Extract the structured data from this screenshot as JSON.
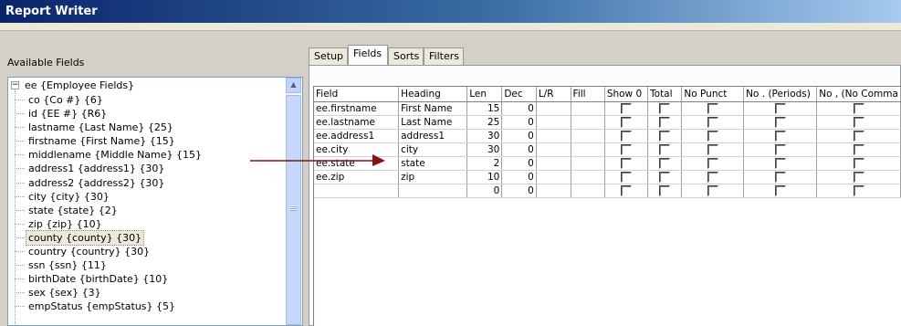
{
  "window": {
    "title": "Report Writer"
  },
  "available_fields": {
    "label": "Available Fields",
    "root": {
      "label": "ee {Employee Fields}",
      "expander": "−"
    },
    "items": [
      "co {Co #} {6}",
      "id {EE #} {R6}",
      "lastname {Last Name} {25}",
      "firstname {First Name} {15}",
      "middlename {Middle Name} {15}",
      "address1 {address1} {30}",
      "address2 {address2} {30}",
      "city {city} {30}",
      "state {state} {2}",
      "zip {zip} {10}",
      "county {county} {30}",
      "country {country} {30}",
      "ssn {ssn} {11}",
      "birthDate {birthDate} {10}",
      "sex {sex} {3}",
      "empStatus {empStatus} {5}"
    ],
    "selected_index": 10
  },
  "tabs": [
    {
      "label": "Setup"
    },
    {
      "label": "Fields"
    },
    {
      "label": "Sorts"
    },
    {
      "label": "Filters"
    }
  ],
  "active_tab": "Fields",
  "grid": {
    "columns": [
      "Field",
      "Heading",
      "Len",
      "Dec",
      "L/R",
      "Fill",
      "Show 0",
      "Total",
      "No Punct",
      "No . (Periods)",
      "No , (No Comma"
    ],
    "rows": [
      {
        "field": "ee.firstname",
        "heading": "First Name",
        "len": "15",
        "dec": "0"
      },
      {
        "field": "ee.lastname",
        "heading": "Last Name",
        "len": "25",
        "dec": "0"
      },
      {
        "field": "ee.address1",
        "heading": "address1",
        "len": "30",
        "dec": "0"
      },
      {
        "field": "ee.city",
        "heading": "city",
        "len": "30",
        "dec": "0"
      },
      {
        "field": "ee.state",
        "heading": "state",
        "len": "2",
        "dec": "0"
      },
      {
        "field": "ee.zip",
        "heading": "zip",
        "len": "10",
        "dec": "0"
      },
      {
        "field": "",
        "heading": "",
        "len": "0",
        "dec": "0"
      }
    ]
  },
  "colors": {
    "title_bar": "#0a246a",
    "arrow": "#8b1010",
    "panel": "#d4d0c8"
  }
}
